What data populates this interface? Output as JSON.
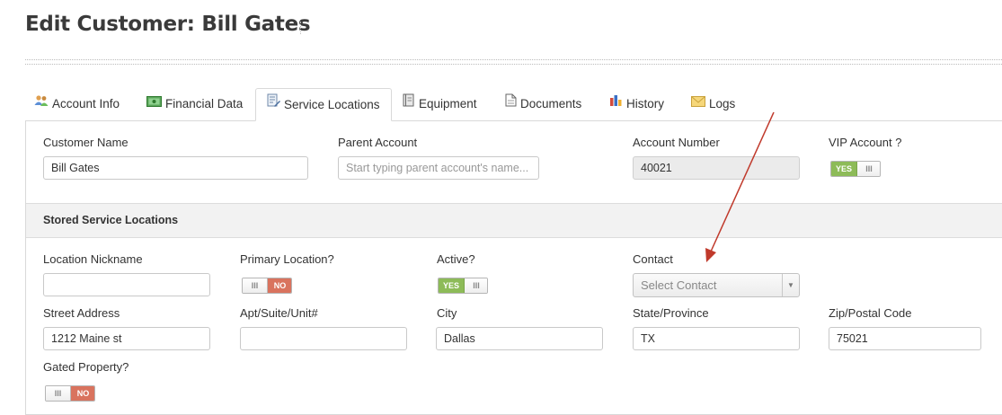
{
  "page": {
    "title": "Edit Customer: Bill Gates"
  },
  "tabs": [
    {
      "label": "Account Info",
      "icon": "users-icon"
    },
    {
      "label": "Financial Data",
      "icon": "money-icon"
    },
    {
      "label": "Service Locations",
      "icon": "document-edit-icon",
      "active": true
    },
    {
      "label": "Equipment",
      "icon": "book-icon"
    },
    {
      "label": "Documents",
      "icon": "document-icon"
    },
    {
      "label": "History",
      "icon": "bar-chart-icon"
    },
    {
      "label": "Logs",
      "icon": "envelope-icon"
    }
  ],
  "customer": {
    "name_label": "Customer Name",
    "name_value": "Bill Gates",
    "parent_label": "Parent Account",
    "parent_placeholder": "Start typing parent account's name...",
    "account_number_label": "Account Number",
    "account_number_value": "40021",
    "vip_label": "VIP Account ?",
    "vip_toggle": {
      "state": "YES",
      "on_text": "YES",
      "grip": "III"
    }
  },
  "section": {
    "title": "Stored Service Locations"
  },
  "location": {
    "nickname_label": "Location Nickname",
    "nickname_value": "",
    "primary_label": "Primary Location?",
    "primary_toggle": {
      "state": "NO",
      "off_text": "NO",
      "grip": "III"
    },
    "active_label": "Active?",
    "active_toggle": {
      "state": "YES",
      "on_text": "YES",
      "grip": "III"
    },
    "contact_label": "Contact",
    "contact_placeholder": "Select Contact",
    "street_label": "Street Address",
    "street_value": "1212 Maine st",
    "apt_label": "Apt/Suite/Unit#",
    "apt_value": "",
    "city_label": "City",
    "city_value": "Dallas",
    "state_label": "State/Province",
    "state_value": "TX",
    "zip_label": "Zip/Postal Code",
    "zip_value": "75021",
    "gated_label": "Gated Property?",
    "gated_toggle": {
      "state": "NO",
      "off_text": "NO",
      "grip": "III"
    }
  },
  "colors": {
    "toggle_yes": "#8dbb58",
    "toggle_no": "#d9735e",
    "annotation_arrow": "#c0392b"
  }
}
